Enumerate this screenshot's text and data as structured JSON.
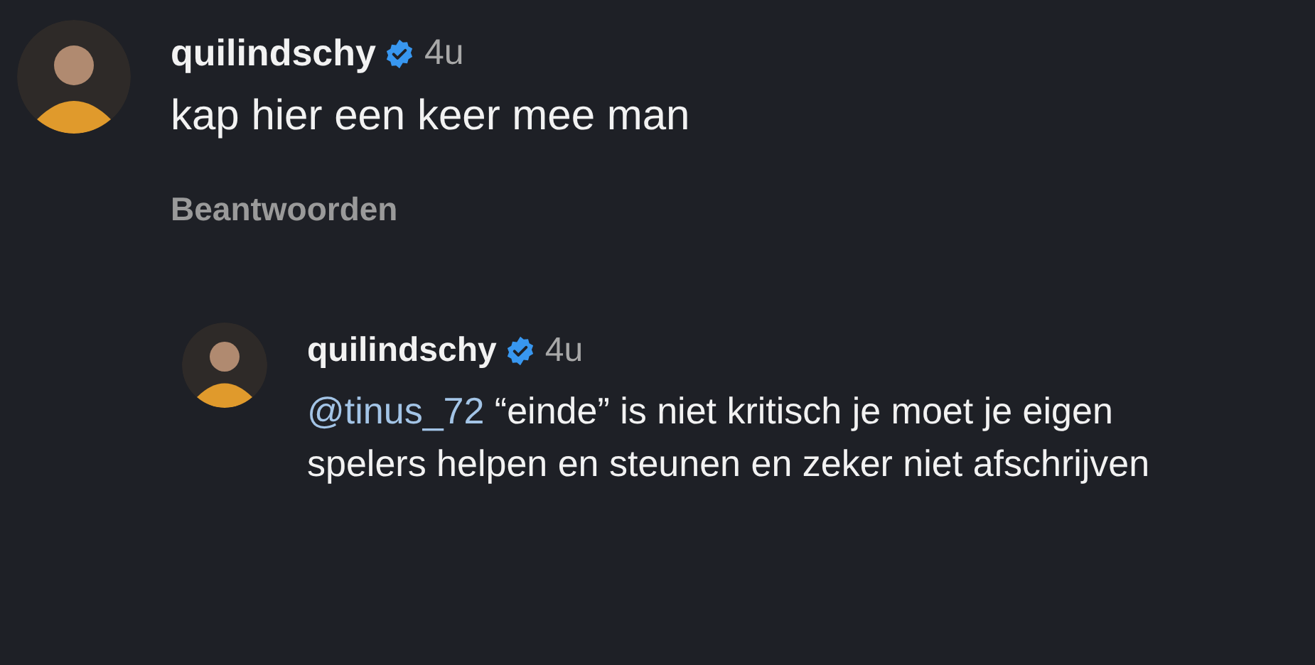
{
  "comments": [
    {
      "username": "quilindschy",
      "verified": true,
      "time": "4u",
      "text": "kap hier een keer mee man",
      "reply_label": "Beantwoorden",
      "replies": [
        {
          "username": "quilindschy",
          "verified": true,
          "time": "4u",
          "mention": "@tinus_72",
          "text": "“einde” is niet kritisch je moet je eigen spelers helpen en steunen en zeker niet afschrijven"
        }
      ]
    }
  ]
}
